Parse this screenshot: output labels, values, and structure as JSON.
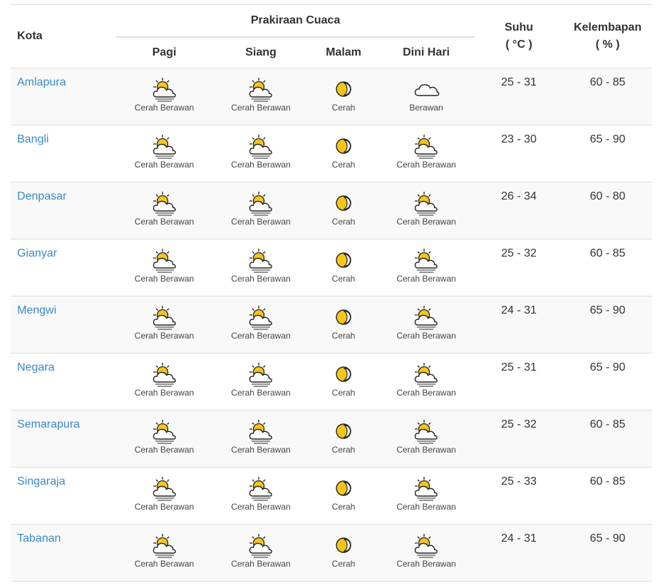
{
  "headers": {
    "kota": "Kota",
    "prakiraan": "Prakiraan Cuaca",
    "pagi": "Pagi",
    "siang": "Siang",
    "malam": "Malam",
    "dini_hari": "Dini Hari",
    "suhu": "Suhu",
    "suhu_unit": "( °C )",
    "kelembapan": "Kelembapan",
    "kelembapan_unit": "( % )"
  },
  "icons": {
    "Cerah Berawan": "partly-cloudy-icon",
    "Cerah": "moon-icon",
    "Berawan": "cloud-icon"
  },
  "rows": [
    {
      "city": "Amlapura",
      "pagi": "Cerah Berawan",
      "siang": "Cerah Berawan",
      "malam": "Cerah",
      "dini": "Berawan",
      "suhu": "25 - 31",
      "kelembapan": "60 - 85"
    },
    {
      "city": "Bangli",
      "pagi": "Cerah Berawan",
      "siang": "Cerah Berawan",
      "malam": "Cerah",
      "dini": "Cerah Berawan",
      "suhu": "23 - 30",
      "kelembapan": "65 - 90"
    },
    {
      "city": "Denpasar",
      "pagi": "Cerah Berawan",
      "siang": "Cerah Berawan",
      "malam": "Cerah",
      "dini": "Cerah Berawan",
      "suhu": "26 - 34",
      "kelembapan": "60 - 80"
    },
    {
      "city": "Gianyar",
      "pagi": "Cerah Berawan",
      "siang": "Cerah Berawan",
      "malam": "Cerah",
      "dini": "Cerah Berawan",
      "suhu": "25 - 32",
      "kelembapan": "60 - 85"
    },
    {
      "city": "Mengwi",
      "pagi": "Cerah Berawan",
      "siang": "Cerah Berawan",
      "malam": "Cerah",
      "dini": "Cerah Berawan",
      "suhu": "24 - 31",
      "kelembapan": "65 - 90"
    },
    {
      "city": "Negara",
      "pagi": "Cerah Berawan",
      "siang": "Cerah Berawan",
      "malam": "Cerah",
      "dini": "Cerah Berawan",
      "suhu": "25 - 31",
      "kelembapan": "65 - 90"
    },
    {
      "city": "Semarapura",
      "pagi": "Cerah Berawan",
      "siang": "Cerah Berawan",
      "malam": "Cerah",
      "dini": "Cerah Berawan",
      "suhu": "25 - 32",
      "kelembapan": "60 - 85"
    },
    {
      "city": "Singaraja",
      "pagi": "Cerah Berawan",
      "siang": "Cerah Berawan",
      "malam": "Cerah",
      "dini": "Cerah Berawan",
      "suhu": "25 - 33",
      "kelembapan": "60 - 85"
    },
    {
      "city": "Tabanan",
      "pagi": "Cerah Berawan",
      "siang": "Cerah Berawan",
      "malam": "Cerah",
      "dini": "Cerah Berawan",
      "suhu": "24 - 31",
      "kelembapan": "65 - 90"
    }
  ]
}
